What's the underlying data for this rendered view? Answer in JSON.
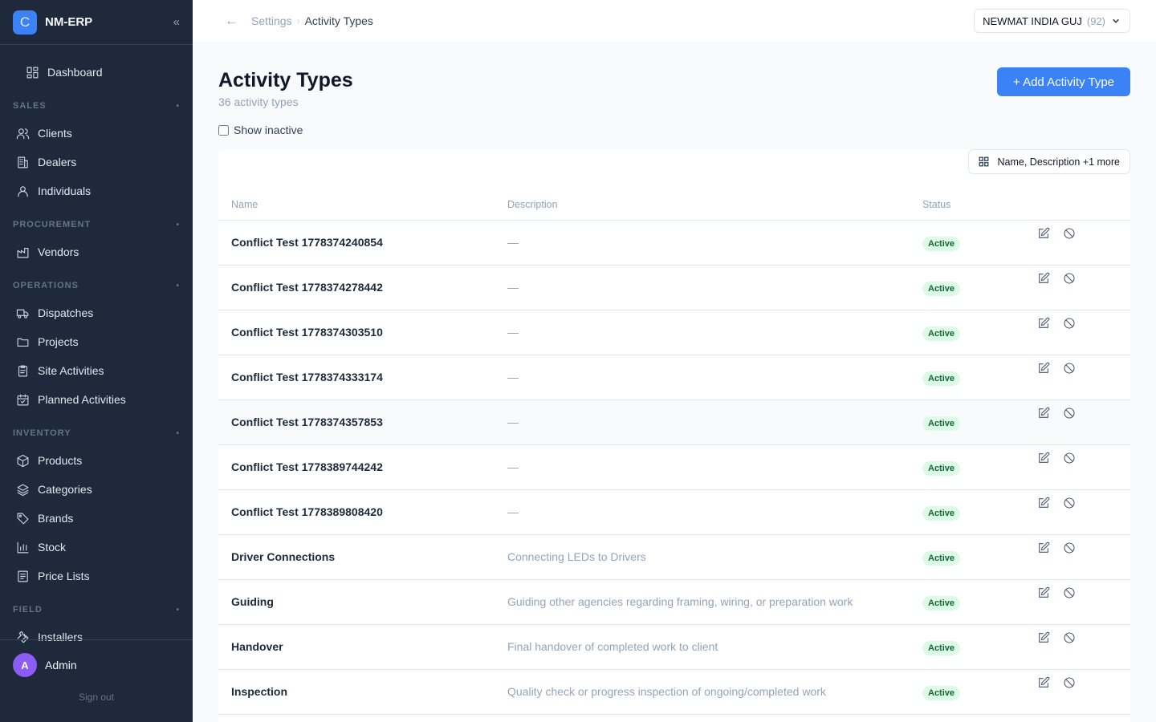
{
  "app": {
    "logo_letter": "C",
    "name": "NM-ERP"
  },
  "sidebar": {
    "dashboard": "Dashboard",
    "sections": [
      {
        "title": "SALES",
        "items": [
          "Clients",
          "Dealers",
          "Individuals"
        ]
      },
      {
        "title": "PROCUREMENT",
        "items": [
          "Vendors"
        ]
      },
      {
        "title": "OPERATIONS",
        "items": [
          "Dispatches",
          "Projects",
          "Site Activities",
          "Planned Activities"
        ]
      },
      {
        "title": "INVENTORY",
        "items": [
          "Products",
          "Categories",
          "Brands",
          "Stock",
          "Price Lists"
        ]
      },
      {
        "title": "FIELD",
        "items": [
          "Installers"
        ]
      }
    ],
    "section_toggle": "•",
    "user": {
      "initial": "A",
      "name": "Admin"
    },
    "sign_out": "Sign out"
  },
  "topbar": {
    "breadcrumb_parent": "Settings",
    "breadcrumb_sep": "›",
    "breadcrumb_current": "Activity Types",
    "org_name": "NEWMAT INDIA GUJ",
    "org_count": "(92)"
  },
  "page": {
    "title": "Activity Types",
    "subtitle": "36 activity types",
    "add_button": "+ Add Activity Type",
    "show_inactive": "Show inactive",
    "show_inactive_checked": false,
    "columns_button": "Name, Description +1 more"
  },
  "table": {
    "headers": {
      "name": "Name",
      "description": "Description",
      "status": "Status"
    },
    "rows": [
      {
        "name": "Conflict Test 1778374240854",
        "description": "—",
        "status": "Active"
      },
      {
        "name": "Conflict Test 1778374278442",
        "description": "—",
        "status": "Active"
      },
      {
        "name": "Conflict Test 1778374303510",
        "description": "—",
        "status": "Active"
      },
      {
        "name": "Conflict Test 1778374333174",
        "description": "—",
        "status": "Active"
      },
      {
        "name": "Conflict Test 1778374357853",
        "description": "—",
        "status": "Active"
      },
      {
        "name": "Conflict Test 1778389744242",
        "description": "—",
        "status": "Active"
      },
      {
        "name": "Conflict Test 1778389808420",
        "description": "—",
        "status": "Active"
      },
      {
        "name": "Driver Connections",
        "description": "Connecting LEDs to Drivers",
        "status": "Active"
      },
      {
        "name": "Guiding",
        "description": "Guiding other agencies regarding framing, wiring, or preparation work",
        "status": "Active"
      },
      {
        "name": "Handover",
        "description": "Final handover of completed work to client",
        "status": "Active"
      },
      {
        "name": "Inspection",
        "description": "Quality check or progress inspection of ongoing/completed work",
        "status": "Active"
      }
    ]
  },
  "colors": {
    "sidebar_bg": "#1e293b",
    "accent": "#3b82f6",
    "active_badge_bg": "#dcfce7",
    "active_badge_text": "#166534"
  }
}
